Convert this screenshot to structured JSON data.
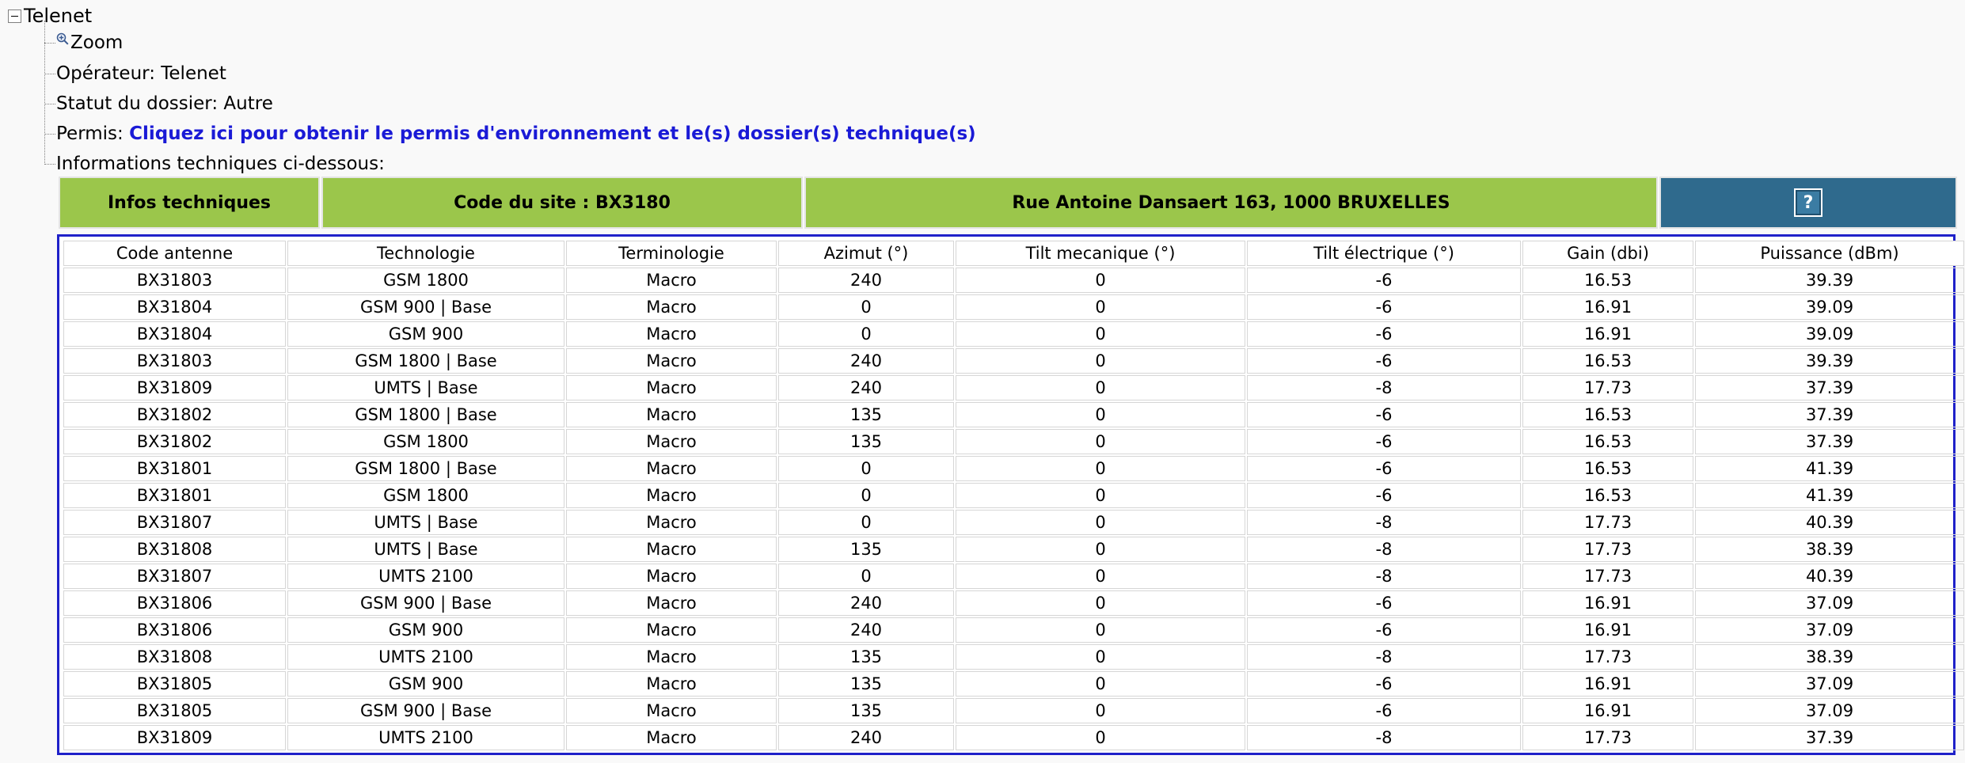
{
  "tree": {
    "root_label": "Telenet",
    "zoom_label": "Zoom",
    "operator": {
      "label": "Opérateur: ",
      "value": "Telenet"
    },
    "status": {
      "label": "Statut du dossier: ",
      "value": "Autre"
    },
    "permit": {
      "label": "Permis: ",
      "link": "Cliquez ici pour obtenir le permis d'environnement et le(s) dossier(s) technique(s)"
    },
    "tech_info_label": "Informations techniques ci-dessous:"
  },
  "info_bar": {
    "title": "Infos techniques",
    "site_code": "Code du site : BX3180",
    "address": "Rue Antoine Dansaert 163, 1000 BRUXELLES",
    "help_icon": "?"
  },
  "colors": {
    "header_green": "#9bc64b",
    "help_blue": "#2f6a8d",
    "table_border": "#1f21c9",
    "link_blue": "#1a1ad6"
  },
  "table": {
    "columns": [
      "Code antenne",
      "Technologie",
      "Terminologie",
      "Azimut (°)",
      "Tilt mecanique (°)",
      "Tilt électrique (°)",
      "Gain (dbi)",
      "Puissance (dBm)"
    ],
    "rows": [
      [
        "BX31803",
        "GSM 1800",
        "Macro",
        "240",
        "0",
        "-6",
        "16.53",
        "39.39"
      ],
      [
        "BX31804",
        "GSM 900 | Base",
        "Macro",
        "0",
        "0",
        "-6",
        "16.91",
        "39.09"
      ],
      [
        "BX31804",
        "GSM 900",
        "Macro",
        "0",
        "0",
        "-6",
        "16.91",
        "39.09"
      ],
      [
        "BX31803",
        "GSM 1800 | Base",
        "Macro",
        "240",
        "0",
        "-6",
        "16.53",
        "39.39"
      ],
      [
        "BX31809",
        "UMTS | Base",
        "Macro",
        "240",
        "0",
        "-8",
        "17.73",
        "37.39"
      ],
      [
        "BX31802",
        "GSM 1800 | Base",
        "Macro",
        "135",
        "0",
        "-6",
        "16.53",
        "37.39"
      ],
      [
        "BX31802",
        "GSM 1800",
        "Macro",
        "135",
        "0",
        "-6",
        "16.53",
        "37.39"
      ],
      [
        "BX31801",
        "GSM 1800 | Base",
        "Macro",
        "0",
        "0",
        "-6",
        "16.53",
        "41.39"
      ],
      [
        "BX31801",
        "GSM 1800",
        "Macro",
        "0",
        "0",
        "-6",
        "16.53",
        "41.39"
      ],
      [
        "BX31807",
        "UMTS | Base",
        "Macro",
        "0",
        "0",
        "-8",
        "17.73",
        "40.39"
      ],
      [
        "BX31808",
        "UMTS | Base",
        "Macro",
        "135",
        "0",
        "-8",
        "17.73",
        "38.39"
      ],
      [
        "BX31807",
        "UMTS 2100",
        "Macro",
        "0",
        "0",
        "-8",
        "17.73",
        "40.39"
      ],
      [
        "BX31806",
        "GSM 900 | Base",
        "Macro",
        "240",
        "0",
        "-6",
        "16.91",
        "37.09"
      ],
      [
        "BX31806",
        "GSM 900",
        "Macro",
        "240",
        "0",
        "-6",
        "16.91",
        "37.09"
      ],
      [
        "BX31808",
        "UMTS 2100",
        "Macro",
        "135",
        "0",
        "-8",
        "17.73",
        "38.39"
      ],
      [
        "BX31805",
        "GSM 900",
        "Macro",
        "135",
        "0",
        "-6",
        "16.91",
        "37.09"
      ],
      [
        "BX31805",
        "GSM 900 | Base",
        "Macro",
        "135",
        "0",
        "-6",
        "16.91",
        "37.09"
      ],
      [
        "BX31809",
        "UMTS 2100",
        "Macro",
        "240",
        "0",
        "-8",
        "17.73",
        "37.39"
      ]
    ]
  }
}
